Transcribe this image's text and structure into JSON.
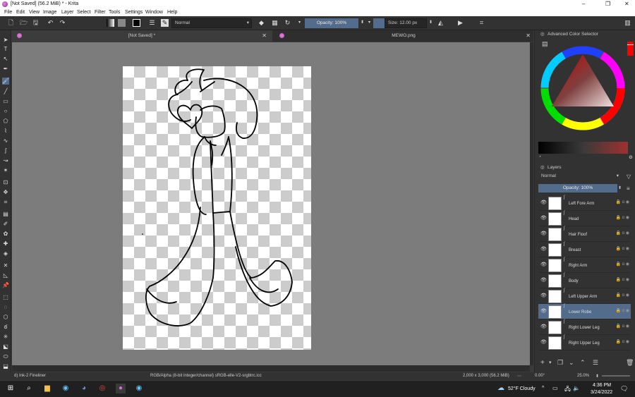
{
  "window": {
    "title": "[Not Saved]  (56.2 MiB)  * - Krita"
  },
  "menu": [
    "File",
    "Edit",
    "View",
    "Image",
    "Layer",
    "Select",
    "Filter",
    "Tools",
    "Settings",
    "Window",
    "Help"
  ],
  "toolbar": {
    "blend_mode": "Normal",
    "opacity_label": "Opacity: 100%",
    "size_label": "Size: 12.00 px"
  },
  "tabs": [
    {
      "label": "[Not Saved]  *"
    },
    {
      "label": "MEWO.png"
    }
  ],
  "color_panel": {
    "title": "Advanced Color Selector"
  },
  "layers_panel": {
    "title": "Layers",
    "blend_mode": "Normal",
    "opacity_label": "Opacity:  100%",
    "layers": [
      {
        "name": "Left Fore Arm",
        "selected": false
      },
      {
        "name": "Head",
        "selected": false
      },
      {
        "name": "Hair Floof",
        "selected": false
      },
      {
        "name": "Breast",
        "selected": false
      },
      {
        "name": "Right Arm",
        "selected": false
      },
      {
        "name": "Body",
        "selected": false
      },
      {
        "name": "Left Upper Arm",
        "selected": false
      },
      {
        "name": "Lower Robe",
        "selected": true
      },
      {
        "name": "Right Lower Leg",
        "selected": false
      },
      {
        "name": "Right Upper Leg",
        "selected": false
      }
    ]
  },
  "status": {
    "brush": "d) Ink-2 Fineliner",
    "color_profile": "RGB/Alpha (8-bit integer/channel)  sRGB-elle-V2-srgbtrc.icc",
    "dimensions": "2,000 x 3,000 (56.2 MiB)",
    "rotation": "0.00°",
    "zoom": "25.0%"
  },
  "taskbar": {
    "weather": "52°F  Cloudy",
    "time": "4:36 PM",
    "date": "3/24/2022"
  },
  "colors": {
    "accent": "#546c8c",
    "canvas_bg": "#7c7c7c",
    "panel_bg": "#323232"
  }
}
